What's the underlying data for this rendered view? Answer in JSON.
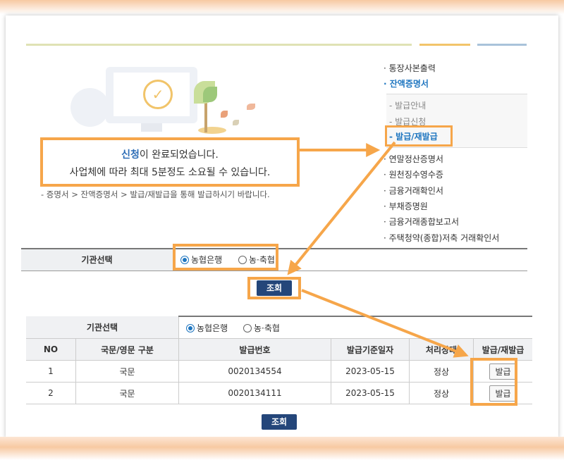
{
  "message": {
    "highlight": "신청",
    "line1_rest": "이 완료되었습니다.",
    "line2": "사업체에 따라 최대 5분정도 소요될 수 있습니다."
  },
  "guide_text": "- 증명서 > 잔액증명서 > 발급/재발급을 통해 발급하시기 바랍니다.",
  "menu": {
    "items_top": [
      "· 통장사본출력",
      "· 잔액증명서"
    ],
    "submenu": [
      "- 발급안내",
      "- 발급신청",
      "- 발급/재발급"
    ],
    "items_bottom": [
      "· 연말정산증명서",
      "· 원천징수영수증",
      "· 금융거래확인서",
      "· 부채증명원",
      "· 금융거래종합보고서",
      "· 주택청약(종합)저축 거래확인서"
    ]
  },
  "selection": {
    "label": "기관선택",
    "options": [
      "농협은행",
      "농·축협"
    ],
    "selected": "농협은행"
  },
  "search_button": "조회",
  "table": {
    "select_label": "기관선택",
    "options": [
      "농협은행",
      "농·축협"
    ],
    "headers": [
      "NO",
      "국문/영문 구분",
      "발급번호",
      "발급기준일자",
      "처리상태",
      "발급/재발급"
    ],
    "rows": [
      {
        "no": "1",
        "lang": "국문",
        "number": "0020134554",
        "date": "2023-05-15",
        "status": "정상",
        "action": "발급"
      },
      {
        "no": "2",
        "lang": "국문",
        "number": "0020134111",
        "date": "2023-05-15",
        "status": "정상",
        "action": "발급"
      }
    ],
    "bottom_button": "조회"
  },
  "colors": {
    "highlight_orange": "#f6a64a",
    "accent_blue": "#1f76c0",
    "button_navy": "#24467a"
  }
}
